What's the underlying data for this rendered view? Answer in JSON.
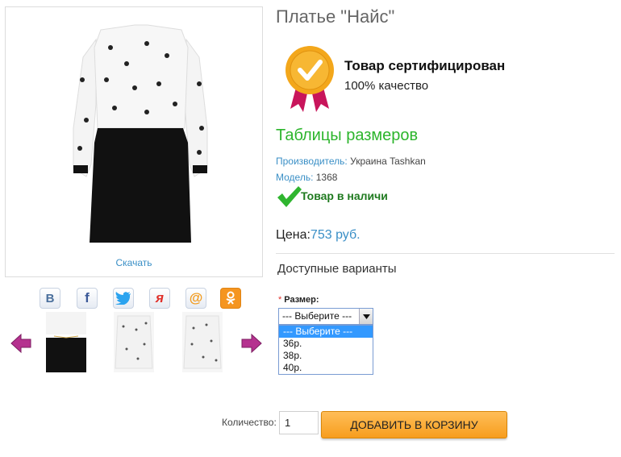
{
  "product": {
    "title": "Платье \"Найс\"",
    "download_label": "Скачать",
    "certificate": {
      "title": "Товар сертифицирован",
      "subtitle": "100% качество"
    },
    "size_table_link": "Таблицы размеров",
    "manufacturer_label": "Производитель:",
    "manufacturer_value": "Украина Tashkan",
    "model_label": "Модель:",
    "model_value": "1368",
    "stock_status": "Товар в наличи",
    "price_label": "Цена:",
    "price_value": "753 руб."
  },
  "options": {
    "heading": "Доступные варианты",
    "size_label": "Размер:",
    "required_mark": "*",
    "selected": "--- Выберите ---",
    "items": [
      "--- Выберите ---",
      "36р.",
      "38р.",
      "40р."
    ]
  },
  "social": [
    {
      "name": "vkontakte",
      "glyph": "B",
      "color": "#4a6f9c"
    },
    {
      "name": "facebook",
      "glyph": "f",
      "color": "#3b5998"
    },
    {
      "name": "twitter",
      "glyph": "🐦",
      "color": "#2aa3ef"
    },
    {
      "name": "moikrug",
      "glyph": "я",
      "color": "#e0302a"
    },
    {
      "name": "mailru",
      "glyph": "@",
      "color": "#f29a1a"
    },
    {
      "name": "odnoklassniki",
      "glyph": "ok",
      "color": "#f59520"
    }
  ],
  "cart": {
    "qty_label": "Количество:",
    "qty_value": "1",
    "add_button": "ДОБАВИТЬ В КОРЗИНУ"
  },
  "colors": {
    "accent_link": "#3a8fc6",
    "green": "#2cb52c",
    "cart_button": "#f79d1e"
  }
}
